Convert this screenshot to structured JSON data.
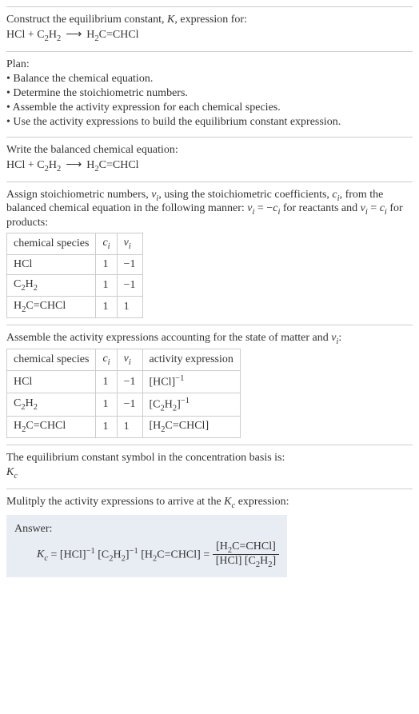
{
  "intro": {
    "line1": "Construct the equilibrium constant, K, expression for:",
    "equation": "HCl + C₂H₂ ⟶ H₂C=CHCl"
  },
  "plan": {
    "heading": "Plan:",
    "b1": "• Balance the chemical equation.",
    "b2": "• Determine the stoichiometric numbers.",
    "b3": "• Assemble the activity expression for each chemical species.",
    "b4": "• Use the activity expressions to build the equilibrium constant expression."
  },
  "balanced": {
    "heading": "Write the balanced chemical equation:",
    "equation": "HCl + C₂H₂ ⟶ H₂C=CHCl"
  },
  "stoich": {
    "text": "Assign stoichiometric numbers, νᵢ, using the stoichiometric coefficients, cᵢ, from the balanced chemical equation in the following manner: νᵢ = −cᵢ for reactants and νᵢ = cᵢ for products:",
    "h1": "chemical species",
    "h2": "cᵢ",
    "h3": "νᵢ",
    "rows": [
      {
        "sp": "HCl",
        "c": "1",
        "v": "−1"
      },
      {
        "sp": "C₂H₂",
        "c": "1",
        "v": "−1"
      },
      {
        "sp": "H₂C=CHCl",
        "c": "1",
        "v": "1"
      }
    ]
  },
  "activity": {
    "text": "Assemble the activity expressions accounting for the state of matter and νᵢ:",
    "h1": "chemical species",
    "h2": "cᵢ",
    "h3": "νᵢ",
    "h4": "activity expression",
    "rows": [
      {
        "sp": "HCl",
        "c": "1",
        "v": "−1",
        "a": "[HCl]⁻¹"
      },
      {
        "sp": "C₂H₂",
        "c": "1",
        "v": "−1",
        "a": "[C₂H₂]⁻¹"
      },
      {
        "sp": "H₂C=CHCl",
        "c": "1",
        "v": "1",
        "a": "[H₂C=CHCl]"
      }
    ]
  },
  "symbol": {
    "text": "The equilibrium constant symbol in the concentration basis is:",
    "sym": "K꜀"
  },
  "final": {
    "text": "Mulitply the activity expressions to arrive at the K꜀ expression:",
    "answer_label": "Answer:",
    "lhs": "K꜀ = [HCl]⁻¹ [C₂H₂]⁻¹ [H₂C=CHCl] = ",
    "num": "[H₂C=CHCl]",
    "den": "[HCl] [C₂H₂]"
  }
}
